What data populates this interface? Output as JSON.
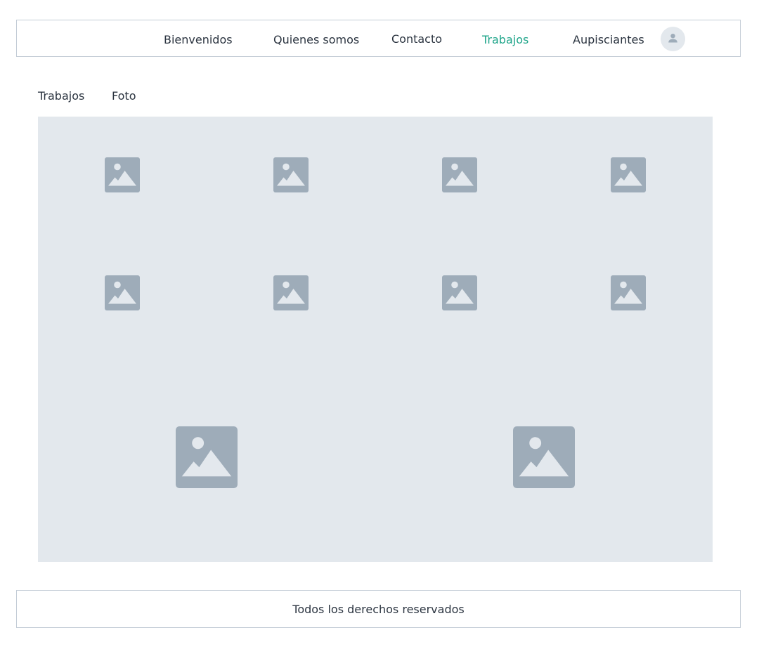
{
  "nav": {
    "items": [
      {
        "label": "Bienvenidos",
        "active": false
      },
      {
        "label": "Quienes somos",
        "active": false
      },
      {
        "label": "Contacto",
        "active": false
      },
      {
        "label": "Trabajos",
        "active": true
      },
      {
        "label": "Aupisciantes",
        "active": false
      }
    ],
    "avatar_icon": "user-icon"
  },
  "subnav": {
    "items": [
      {
        "label": "Trabajos"
      },
      {
        "label": "Foto"
      }
    ]
  },
  "gallery": {
    "thumbnail_icon": "image-placeholder-icon",
    "rows": [
      {
        "count": 4
      },
      {
        "count": 4
      },
      {
        "count": 2
      }
    ]
  },
  "footer": {
    "text": "Todos los derechos reservados"
  },
  "colors": {
    "accent": "#1fa58a",
    "text": "#2b3440",
    "border": "#c3ccd6",
    "panel": "#e3e8ed",
    "placeholder": "#9eacb9"
  }
}
